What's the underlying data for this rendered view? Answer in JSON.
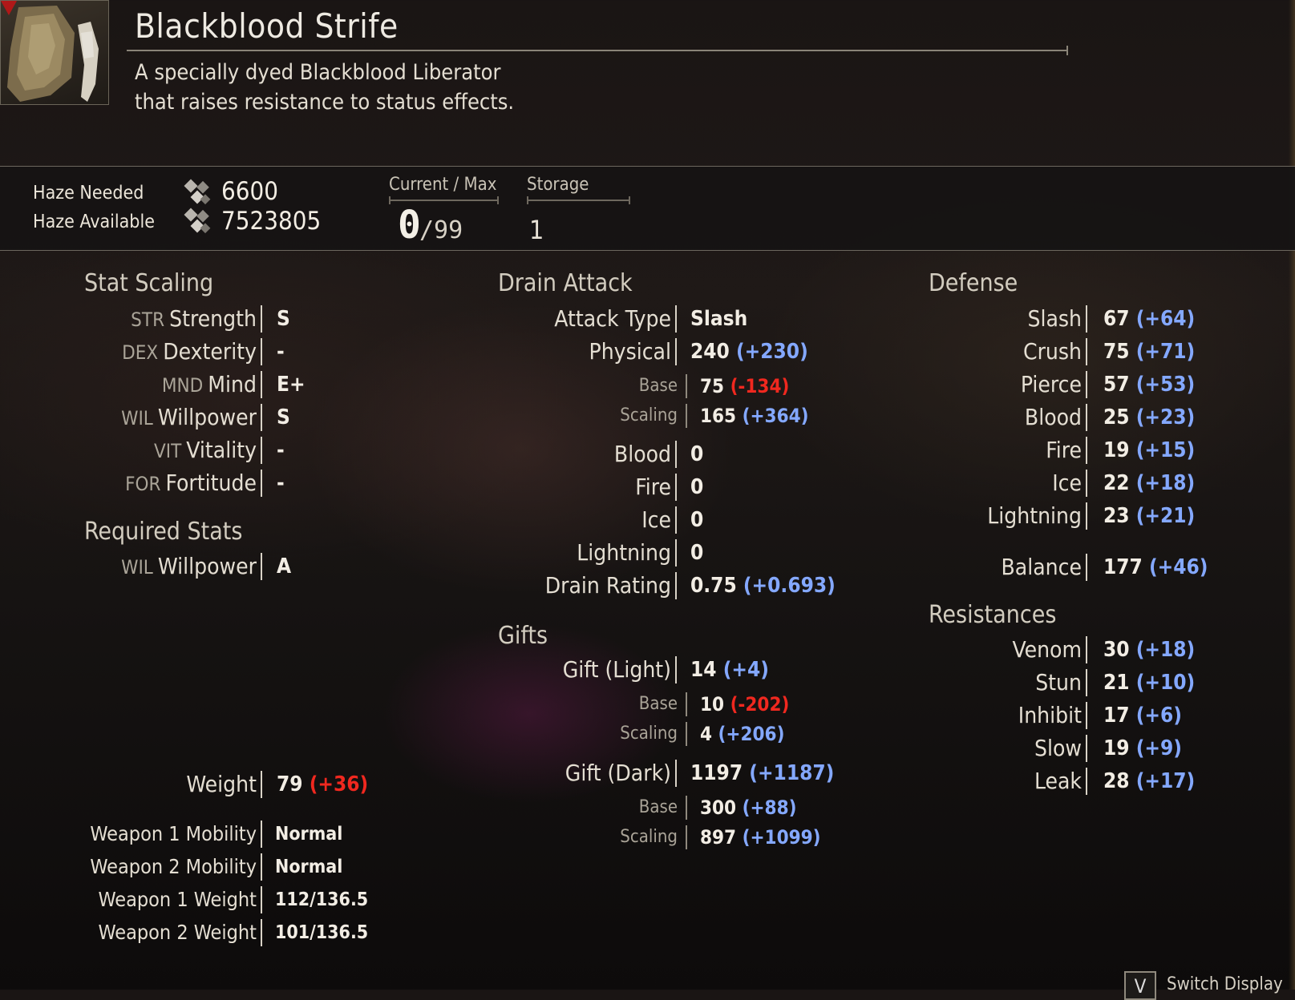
{
  "item": {
    "name": "Blackblood Strife",
    "description_line1": "A specially dyed Blackblood Liberator",
    "description_line2": "that raises resistance to status effects."
  },
  "haze": {
    "needed_label": "Haze Needed",
    "needed_value": "6600",
    "available_label": "Haze Available",
    "available_value": "7523805",
    "current_max_label": "Current / Max",
    "current_value": "0",
    "max_value": "/99",
    "storage_label": "Storage",
    "storage_value": "1"
  },
  "stat_scaling": {
    "title": "Stat Scaling",
    "rows": [
      {
        "abbr": "STR",
        "name": "Strength",
        "grade": "S"
      },
      {
        "abbr": "DEX",
        "name": "Dexterity",
        "grade": "-"
      },
      {
        "abbr": "MND",
        "name": "Mind",
        "grade": "E+"
      },
      {
        "abbr": "WIL",
        "name": "Willpower",
        "grade": "S"
      },
      {
        "abbr": "VIT",
        "name": "Vitality",
        "grade": "-"
      },
      {
        "abbr": "FOR",
        "name": "Fortitude",
        "grade": "-"
      }
    ]
  },
  "required_stats": {
    "title": "Required Stats",
    "rows": [
      {
        "abbr": "WIL",
        "name": "Willpower",
        "grade": "A"
      }
    ]
  },
  "weight": {
    "label": "Weight",
    "value": "79",
    "delta": "(+36)"
  },
  "mobility": {
    "weapon1_mobility_label": "Weapon 1 Mobility",
    "weapon1_mobility_value": "Normal",
    "weapon2_mobility_label": "Weapon 2 Mobility",
    "weapon2_mobility_value": "Normal",
    "weapon1_weight_label": "Weapon 1 Weight",
    "weapon1_weight_value": "112/136.5",
    "weapon2_weight_label": "Weapon 2 Weight",
    "weapon2_weight_value": "101/136.5"
  },
  "drain_attack": {
    "title": "Drain Attack",
    "attack_type_label": "Attack Type",
    "attack_type_value": "Slash",
    "physical_label": "Physical",
    "physical_value": "240",
    "physical_delta": "(+230)",
    "base_label": "Base",
    "base_value": "75",
    "base_delta": "(-134)",
    "scaling_label": "Scaling",
    "scaling_value": "165",
    "scaling_delta": "(+364)",
    "blood_label": "Blood",
    "blood_value": "0",
    "fire_label": "Fire",
    "fire_value": "0",
    "ice_label": "Ice",
    "ice_value": "0",
    "lightning_label": "Lightning",
    "lightning_value": "0",
    "drain_rating_label": "Drain Rating",
    "drain_rating_value": "0.75",
    "drain_rating_delta": "(+0.693)"
  },
  "gifts": {
    "title": "Gifts",
    "light_label": "Gift (Light)",
    "light_value": "14",
    "light_delta": "(+4)",
    "light_base_label": "Base",
    "light_base_value": "10",
    "light_base_delta": "(-202)",
    "light_scaling_label": "Scaling",
    "light_scaling_value": "4",
    "light_scaling_delta": "(+206)",
    "dark_label": "Gift (Dark)",
    "dark_value": "1197",
    "dark_delta": "(+1187)",
    "dark_base_label": "Base",
    "dark_base_value": "300",
    "dark_base_delta": "(+88)",
    "dark_scaling_label": "Scaling",
    "dark_scaling_value": "897",
    "dark_scaling_delta": "(+1099)"
  },
  "defense": {
    "title": "Defense",
    "rows": [
      {
        "name": "Slash",
        "value": "67",
        "delta": "(+64)"
      },
      {
        "name": "Crush",
        "value": "75",
        "delta": "(+71)"
      },
      {
        "name": "Pierce",
        "value": "57",
        "delta": "(+53)"
      },
      {
        "name": "Blood",
        "value": "25",
        "delta": "(+23)"
      },
      {
        "name": "Fire",
        "value": "19",
        "delta": "(+15)"
      },
      {
        "name": "Ice",
        "value": "22",
        "delta": "(+18)"
      },
      {
        "name": "Lightning",
        "value": "23",
        "delta": "(+21)"
      }
    ],
    "balance_label": "Balance",
    "balance_value": "177",
    "balance_delta": "(+46)"
  },
  "resistances": {
    "title": "Resistances",
    "rows": [
      {
        "name": "Venom",
        "value": "30",
        "delta": "(+18)"
      },
      {
        "name": "Stun",
        "value": "21",
        "delta": "(+10)"
      },
      {
        "name": "Inhibit",
        "value": "17",
        "delta": "(+6)"
      },
      {
        "name": "Slow",
        "value": "19",
        "delta": "(+9)"
      },
      {
        "name": "Leak",
        "value": "28",
        "delta": "(+17)"
      }
    ]
  },
  "footer": {
    "switch_key": "V",
    "switch_label": "Switch Display"
  },
  "colors": {
    "positive_delta": "#84a8ff",
    "negative_delta": "#f0281f",
    "text": "#e8e2d6"
  }
}
